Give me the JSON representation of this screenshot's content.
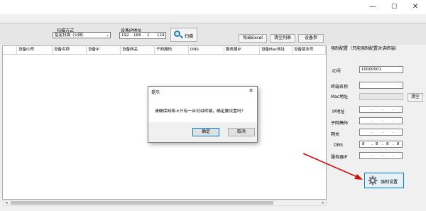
{
  "window": {
    "title": "",
    "minimize_glyph": "—",
    "maximize_glyph": "☐",
    "close_glyph": "✕"
  },
  "toolbar": {
    "scan_mode_label": "扫描方式",
    "scan_mode_value": "指定扫描（公网）",
    "device_ip_label": "设备IP地址",
    "device_ip": [
      "192",
      "168",
      "1",
      "124"
    ],
    "scan_button": "扫描",
    "export_button": "导出Excel",
    "clear_button": "清空列表",
    "params_button": "设备参"
  },
  "table": {
    "columns": [
      "设备ID号",
      "设备名称",
      "设备IP",
      "设备网关",
      "子网掩码",
      "DNS",
      "服务器IP",
      "设备Mac地址",
      "设备版本号"
    ]
  },
  "right_panel": {
    "title": "强制配置（只能强制配置对讲终端）",
    "fields": [
      {
        "label": "ID号",
        "value": "10000001"
      },
      {
        "label": "终端名称",
        "value": ""
      },
      {
        "label": "Mac地址",
        "value": ""
      },
      {
        "label": "IP地址",
        "value": ""
      },
      {
        "label": "子网掩码",
        "value": ""
      },
      {
        "label": "网关",
        "value": ""
      },
      {
        "label": "DNS",
        "value": ""
      },
      {
        "label": "服务器IP",
        "value": ""
      }
    ],
    "dns_values": [
      "8",
      "8",
      "8",
      "8"
    ],
    "clear_button": "清空",
    "set_button": "强制设置"
  },
  "dialog": {
    "title": "提示",
    "close_glyph": "✕",
    "message": "请确保网络上只有一台对讲终端，确定要设置吗？",
    "ok_button": "确定",
    "cancel_button": "取消"
  },
  "colors": {
    "arrow": "#cc1111",
    "accent": "#0078d7"
  },
  "icons": {
    "scan": "magnifier-icon",
    "set": "gear-icon"
  }
}
